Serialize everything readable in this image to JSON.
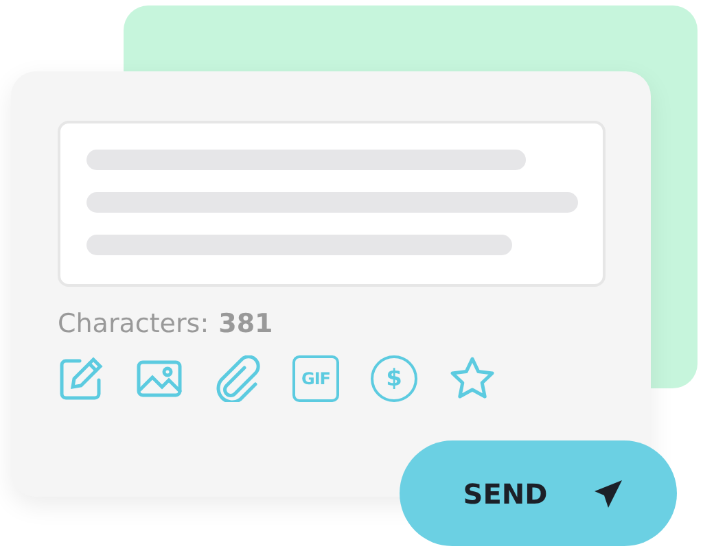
{
  "counter": {
    "label": "Characters:",
    "value": "381"
  },
  "toolbar": [
    {
      "kind": "edit"
    },
    {
      "kind": "image"
    },
    {
      "kind": "attach"
    },
    {
      "kind": "gif",
      "label": "GIF"
    },
    {
      "kind": "money",
      "label": "$"
    },
    {
      "kind": "star"
    }
  ],
  "send_button": {
    "label": "SEND"
  }
}
